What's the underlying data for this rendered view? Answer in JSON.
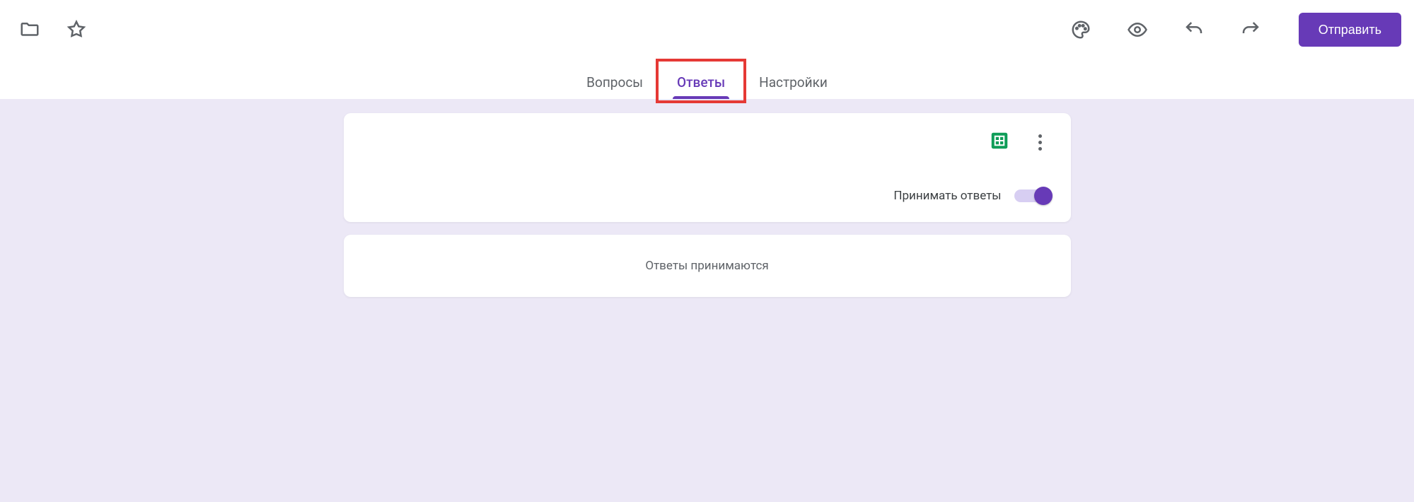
{
  "header": {
    "send_label": "Отправить"
  },
  "tabs": {
    "items": [
      {
        "label": "Вопросы",
        "active": false
      },
      {
        "label": "Ответы",
        "active": true
      },
      {
        "label": "Настройки",
        "active": false
      }
    ]
  },
  "responses": {
    "accept_label": "Принимать ответы",
    "accepting": true,
    "status_text": "Ответы принимаются"
  },
  "icons": {
    "folder": "folder-icon",
    "star": "star-icon",
    "palette": "palette-icon",
    "eye": "preview-icon",
    "undo": "undo-icon",
    "redo": "redo-icon",
    "sheets": "sheets-icon",
    "kebab": "more-icon"
  },
  "colors": {
    "accent": "#673ab7",
    "body_bg": "#ece8f6",
    "highlight_box": "#e53935",
    "sheets_green": "#0f9d58"
  }
}
